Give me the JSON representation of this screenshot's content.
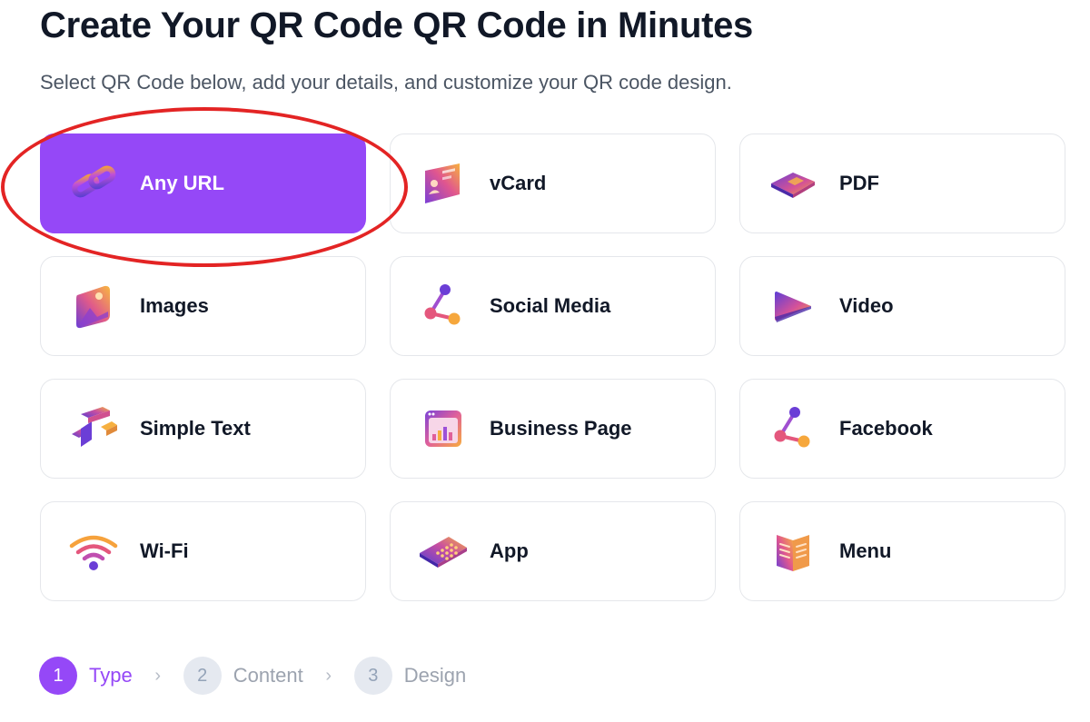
{
  "header": {
    "title": "Create Your QR Code QR Code in Minutes",
    "subtitle": "Select QR Code below, add your details, and customize your QR code design."
  },
  "qr_types": [
    {
      "label": "Any URL",
      "icon": "link-chain-icon",
      "selected": true
    },
    {
      "label": "vCard",
      "icon": "contact-card-icon",
      "selected": false
    },
    {
      "label": "PDF",
      "icon": "pdf-file-icon",
      "selected": false
    },
    {
      "label": "Images",
      "icon": "image-photo-icon",
      "selected": false
    },
    {
      "label": "Social Media",
      "icon": "share-nodes-icon",
      "selected": false
    },
    {
      "label": "Video",
      "icon": "play-video-icon",
      "selected": false
    },
    {
      "label": "Simple Text",
      "icon": "text-block-icon",
      "selected": false
    },
    {
      "label": "Business Page",
      "icon": "business-page-icon",
      "selected": false
    },
    {
      "label": "Facebook",
      "icon": "share-nodes-icon",
      "selected": false
    },
    {
      "label": "Wi-Fi",
      "icon": "wifi-icon",
      "selected": false
    },
    {
      "label": "App",
      "icon": "app-grid-icon",
      "selected": false
    },
    {
      "label": "Menu",
      "icon": "menu-book-icon",
      "selected": false
    }
  ],
  "stepper": {
    "steps": [
      {
        "number": "1",
        "label": "Type",
        "current": true
      },
      {
        "number": "2",
        "label": "Content",
        "current": false
      },
      {
        "number": "3",
        "label": "Design",
        "current": false
      }
    ],
    "separator": "›"
  },
  "colors": {
    "accent": "#9548f7",
    "annotation_ring": "#e32424",
    "card_border": "#e5e7eb",
    "text_dark": "#111827",
    "text_muted": "#4b5563"
  }
}
